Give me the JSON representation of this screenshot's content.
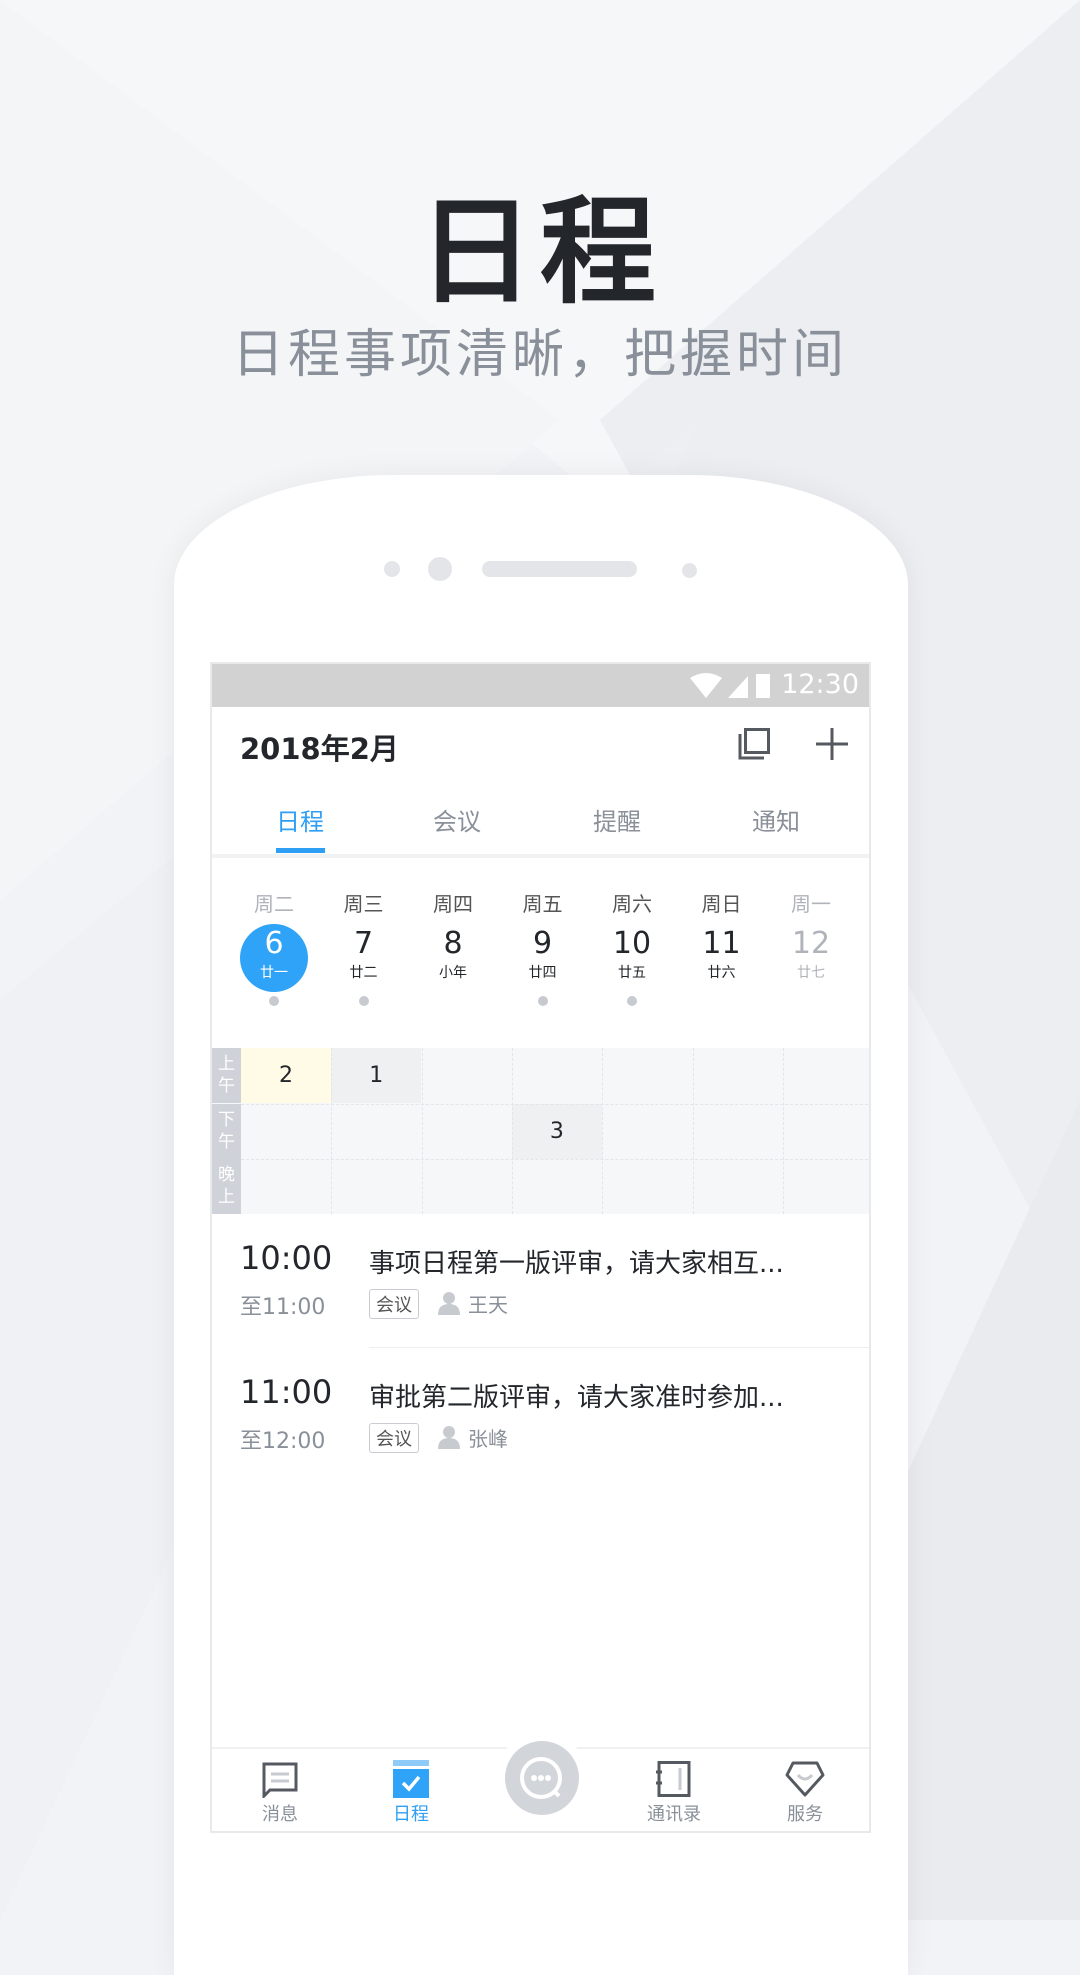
{
  "headline": "日程",
  "subtitle": "日程事项清晰，把握时间",
  "status_bar": {
    "time": "12:30",
    "icons": [
      "wifi-icon",
      "signal-icon",
      "battery-icon"
    ]
  },
  "header": {
    "title": "2018年2月",
    "actions": [
      "copy-icon",
      "plus-icon"
    ]
  },
  "tabs": [
    {
      "label": "日程",
      "active": true
    },
    {
      "label": "会议"
    },
    {
      "label": "提醒"
    },
    {
      "label": "通知"
    }
  ],
  "week": [
    {
      "weekday": "周二",
      "day": "6",
      "lunar": "廿一",
      "selected": true,
      "has_event": true
    },
    {
      "weekday": "周三",
      "day": "7",
      "lunar": "廿二",
      "has_event": true
    },
    {
      "weekday": "周四",
      "day": "8",
      "lunar": "小年"
    },
    {
      "weekday": "周五",
      "day": "9",
      "lunar": "廿四",
      "has_event": true
    },
    {
      "weekday": "周六",
      "day": "10",
      "lunar": "廿五",
      "has_event": true
    },
    {
      "weekday": "周日",
      "day": "11",
      "lunar": "廿六"
    },
    {
      "weekday": "周一",
      "day": "12",
      "lunar": "廿七",
      "faded": true
    }
  ],
  "grid": {
    "rows": [
      "上午",
      "下午",
      "晚上"
    ],
    "cells": [
      {
        "row": 0,
        "col": 0,
        "count": "2",
        "color": "#fffbe6"
      },
      {
        "row": 0,
        "col": 1,
        "count": "1",
        "color": "#eff0f2"
      },
      {
        "row": 1,
        "col": 3,
        "count": "3",
        "color": "#eff0f2"
      }
    ]
  },
  "events": [
    {
      "start": "10:00",
      "end": "至11:00",
      "title": "事项日程第一版评审，请大家相互...",
      "tag": "会议",
      "person": "王天"
    },
    {
      "start": "11:00",
      "end": "至12:00",
      "title": "审批第二版评审，请大家准时参加...",
      "tag": "会议",
      "person": "张峰"
    }
  ],
  "nav": [
    {
      "label": "消息",
      "icon": "message-icon"
    },
    {
      "label": "日程",
      "icon": "calendar-check-icon",
      "active": true
    },
    {
      "label": "",
      "icon": "chat-search-icon"
    },
    {
      "label": "通讯录",
      "icon": "contacts-book-icon"
    },
    {
      "label": "服务",
      "icon": "service-gem-icon"
    }
  ],
  "colors": {
    "accent": "#2f9ff5",
    "text": "#23262b",
    "muted": "#8a9099"
  }
}
